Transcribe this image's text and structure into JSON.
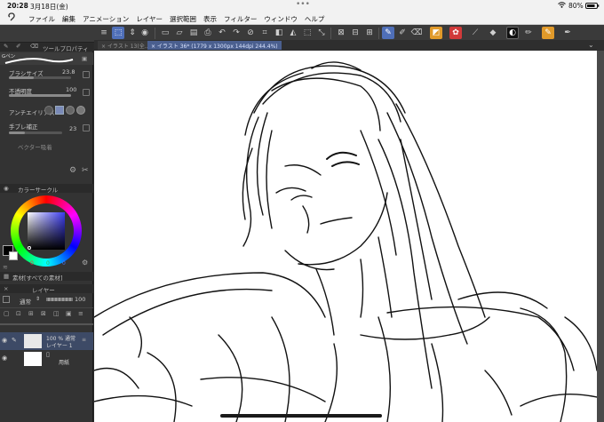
{
  "status": {
    "time": "20:28",
    "date": "3月18日(金)",
    "dots": "•••",
    "battery": "80%"
  },
  "menu": [
    "ファイル",
    "編集",
    "アニメーション",
    "レイヤー",
    "選択範囲",
    "表示",
    "フィルター",
    "ウィンドウ",
    "ヘルプ"
  ],
  "tool_property": {
    "title": "ツールプロパティ",
    "brush_name": "Gペン",
    "brush_size_label": "ブラシサイズ",
    "brush_size_value": "23.8",
    "opacity_label": "不透明度",
    "opacity_value": "100",
    "antialias_label": "アンチエイリアス",
    "stabilizer_label": "手ブレ補正",
    "stabilizer_value": "23",
    "vector_label": "ベクター吸着"
  },
  "color_circle": {
    "title": "カラーサークル",
    "hue_color": "#3c3cf0",
    "fg_color": "#000000",
    "bg_color": "#ffffff",
    "values": [
      "0",
      "0",
      "0"
    ],
    "value_colors": [
      "#e84040",
      "#3fbf3f",
      "#4a7aff"
    ]
  },
  "material": {
    "title": "素材[すべての素材]"
  },
  "layer": {
    "title": "レイヤー",
    "blend_mode": "通常",
    "opacity": "100",
    "layers": [
      {
        "line1": "100 % 通常",
        "line2": "レイヤー 1"
      },
      {
        "line1": "",
        "line2": "用紙"
      }
    ]
  },
  "doc_tabs": [
    {
      "label": "× イラスト 13(全…"
    },
    {
      "label": "× イラスト 36* (1779 x 1300px 144dpi 244.4%)"
    }
  ],
  "colors": {
    "accent": "#4f6fb8",
    "panel": "#333333",
    "toolbar": "#3a3a3a",
    "menubar": "#f2f2f2"
  },
  "toolbar_icons": [
    "hamburger-icon",
    "select-tool-icon",
    "eye-icon",
    "new-file-icon",
    "open-icon",
    "save-icon",
    "print-icon",
    "cloud-icon",
    "undo-icon",
    "redo-icon",
    "deselect-icon",
    "transform-icon",
    "fill-icon",
    "lasso-icon",
    "pen-tool-icon",
    "brush-tool-icon",
    "eraser-icon",
    "color-set-icon",
    "fill-bucket-icon",
    "gradient-icon",
    "pen-icon"
  ]
}
